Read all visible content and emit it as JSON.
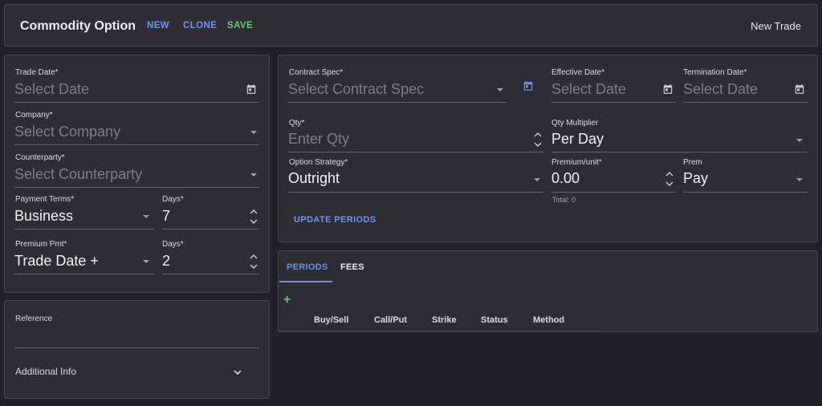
{
  "toolbar": {
    "title": "Commodity Option",
    "new_label": "NEW",
    "clone_label": "CLONE",
    "save_label": "SAVE",
    "status": "New Trade"
  },
  "left_form": {
    "trade_date": {
      "label": "Trade Date*",
      "placeholder": "Select Date"
    },
    "company": {
      "label": "Company*",
      "placeholder": "Select Company"
    },
    "counterparty": {
      "label": "Counterparty*",
      "placeholder": "Select Counterparty"
    },
    "payment_terms": {
      "label": "Payment Terms*",
      "value": "Business"
    },
    "payment_days": {
      "label": "Days*",
      "value": "7"
    },
    "premium_pmt": {
      "label": "Premium Pmt*",
      "value": "Trade Date +"
    },
    "premium_days": {
      "label": "Days*",
      "value": "2"
    }
  },
  "reference": {
    "label": "Reference",
    "additional_info": "Additional Info"
  },
  "main_form": {
    "contract_spec": {
      "label": "Contract Spec*",
      "placeholder": "Select Contract Spec"
    },
    "effective_date": {
      "label": "Effective Date*",
      "placeholder": "Select Date"
    },
    "termination_date": {
      "label": "Termination Date*",
      "placeholder": "Select Date"
    },
    "qty": {
      "label": "Qty*",
      "placeholder": "Enter Qty"
    },
    "qty_multiplier": {
      "label": "Qty Multiplier",
      "value": "Per Day"
    },
    "option_strategy": {
      "label": "Option Strategy*",
      "value": "Outright"
    },
    "premium_unit": {
      "label": "Premium/unit*",
      "value": "0.00",
      "hint": "Total: 0"
    },
    "prem": {
      "label": "Prem",
      "value": "Pay"
    },
    "update_periods_label": "UPDATE PERIODS"
  },
  "periods": {
    "tabs": [
      "PERIODS",
      "FEES"
    ],
    "add_icon": "+",
    "columns": [
      "Buy/Sell",
      "Call/Put",
      "Strike",
      "Status",
      "Method"
    ]
  },
  "colors": {
    "blue": "#7393f5",
    "green": "#6cc67a",
    "tab_blue": "#6d8fd8"
  }
}
